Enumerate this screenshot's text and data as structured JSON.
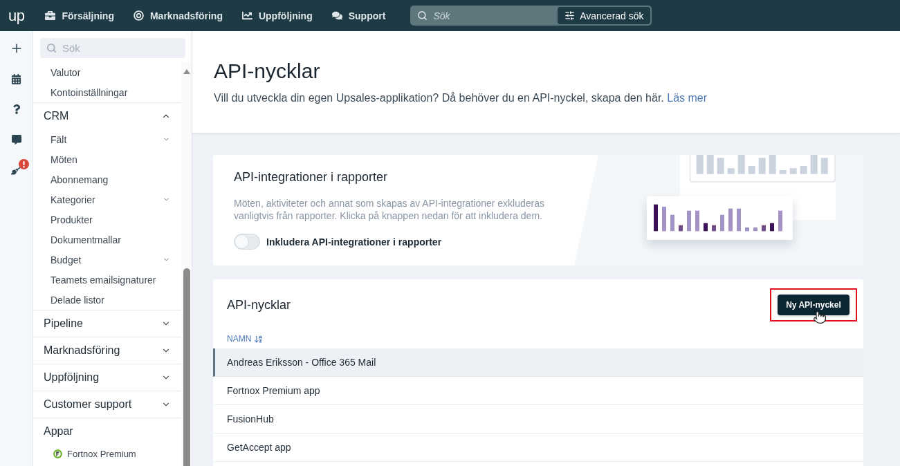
{
  "top_bar": {
    "logo": "up",
    "nav": [
      {
        "label": "Försäljning"
      },
      {
        "label": "Marknadsföring"
      },
      {
        "label": "Uppföljning"
      },
      {
        "label": "Support"
      }
    ],
    "search": {
      "placeholder": "Sök",
      "advanced_button": "Avancerad sök"
    }
  },
  "rail": [
    {
      "alert": false
    },
    {
      "alert": false
    },
    {
      "alert": false
    },
    {
      "alert": false
    },
    {
      "alert": true
    }
  ],
  "sidebar": {
    "search": {
      "placeholder": "Sök"
    },
    "sections": [
      {
        "items": [
          {
            "label": "Valutor",
            "expandable": false
          },
          {
            "label": "Kontoinställningar",
            "expandable": false
          }
        ]
      },
      {
        "title": "CRM",
        "collapsible": true,
        "expanded": true,
        "items": [
          {
            "label": "Fält",
            "expandable": true
          },
          {
            "label": "Möten",
            "expandable": false
          },
          {
            "label": "Abonnemang",
            "expandable": false
          },
          {
            "label": "Kategorier",
            "expandable": true
          },
          {
            "label": "Produkter",
            "expandable": false
          },
          {
            "label": "Dokumentmallar",
            "expandable": false
          },
          {
            "label": "Budget",
            "expandable": true
          },
          {
            "label": "Teamets emailsignaturer",
            "expandable": false
          },
          {
            "label": "Delade listor",
            "expandable": false
          }
        ]
      },
      {
        "title": "Pipeline",
        "collapsible": true,
        "expanded": false
      },
      {
        "title": "Marknadsföring",
        "collapsible": true,
        "expanded": false
      },
      {
        "title": "Uppföljning",
        "collapsible": true,
        "expanded": false
      },
      {
        "title": "Customer support",
        "collapsible": true,
        "expanded": false
      },
      {
        "title": "Appar",
        "collapsible": false,
        "items": [
          {
            "label": "Fortnox Premium",
            "kind": "app"
          }
        ]
      }
    ]
  },
  "page_header": {
    "title": "API-nycklar",
    "description": "Vill du utveckla din egen Upsales-applikation? Då behöver du en API-nyckel, skapa den här.",
    "link": "Läs mer"
  },
  "report_card": {
    "title": "API-integrationer i rapporter",
    "description": "Möten, aktiviteter och annat som skapas av API-integrationer exkluderas vanligtvis från rapporter. Klicka på knappen nedan för att inkludera dem.",
    "toggle": {
      "label": "Inkludera API-integrationer i rapporter",
      "on": false
    }
  },
  "keys_card": {
    "title": "API-nycklar",
    "new_button": {
      "label": "Ny API-nyckel",
      "highlighted": true
    },
    "table": {
      "columns": [
        {
          "label": "NAMN",
          "sorted": true
        }
      ],
      "rows": [
        {
          "name": "Andreas Eriksson - Office 365 Mail",
          "selected": true
        },
        {
          "name": "Fortnox Premium app",
          "selected": false
        },
        {
          "name": "FusionHub",
          "selected": false
        },
        {
          "name": "GetAccept app",
          "selected": false
        }
      ]
    }
  }
}
